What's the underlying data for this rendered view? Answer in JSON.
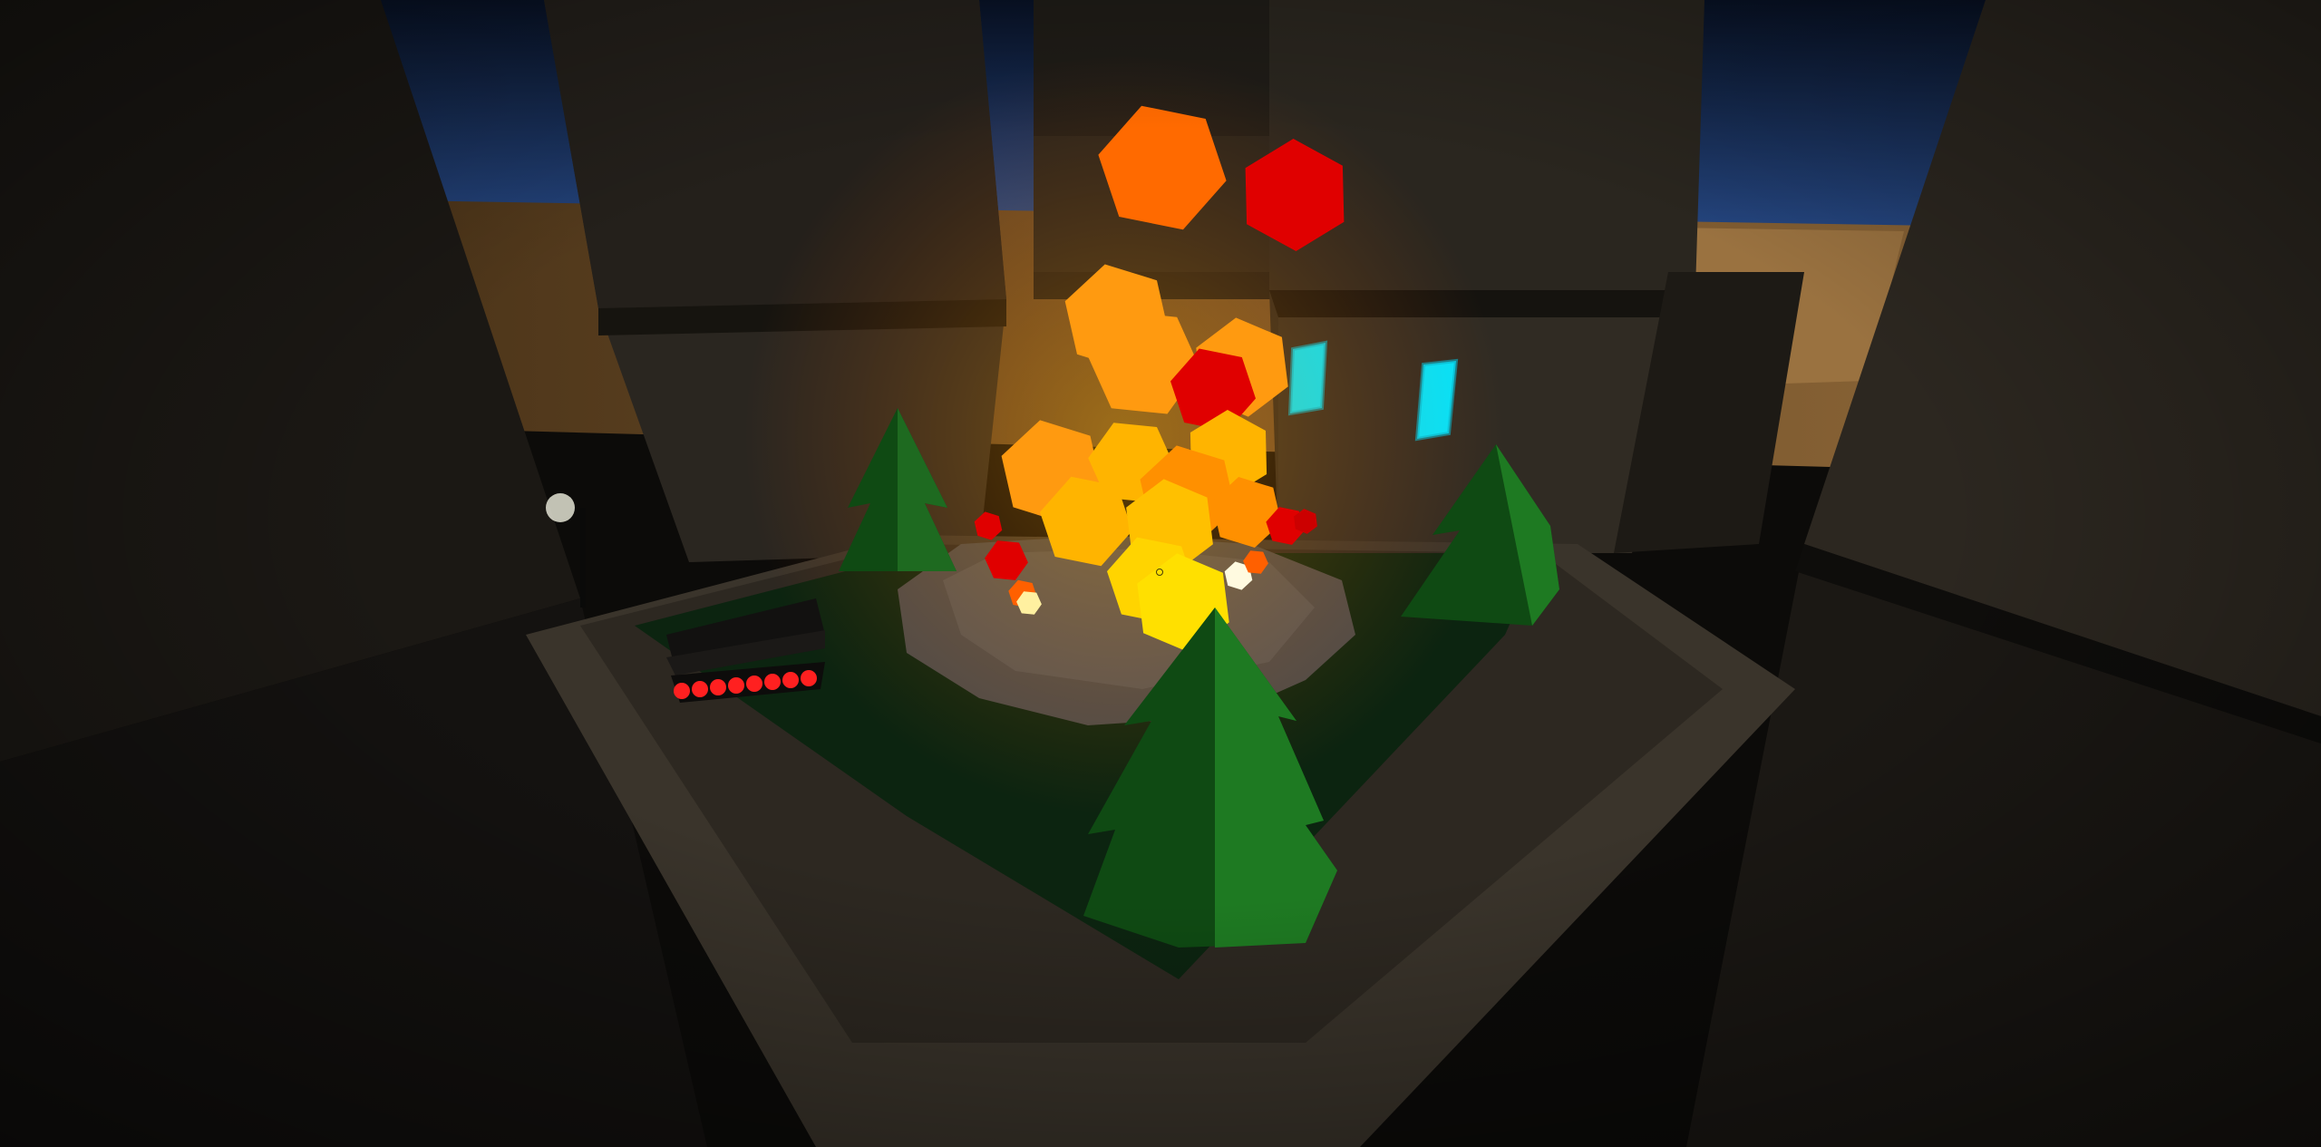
{
  "scene": {
    "setting": "night-courtyard",
    "palette": {
      "sky_top": "#0a1530",
      "sky_horizon": "#2a4d8a",
      "desert_ground": "#6b4a22",
      "building": "#2b2620",
      "building_shadow": "#15130f",
      "paving": "#3a352c",
      "grass": "#0d2a10",
      "pine_light": "#1e7a22",
      "pine_dark": "#0f4a13",
      "smoke": "#4a4a4a",
      "fire_yellow": "#ffd400",
      "fire_orange": "#ff8a00",
      "fire_red": "#e00000",
      "window_glow": "#00e5ff",
      "tank_glow": "#ff2020"
    },
    "entities": [
      {
        "kind": "explosion",
        "icon": "fireball-icon"
      },
      {
        "kind": "tank",
        "icon": "tank-icon"
      },
      {
        "kind": "pine-tree",
        "count": 3,
        "icon": "pine-tree-icon"
      },
      {
        "kind": "building",
        "count": 6,
        "icon": "building-icon"
      },
      {
        "kind": "glowing-window",
        "count": 2,
        "icon": "window-icon"
      }
    ]
  },
  "hud": {
    "crosshair": "crosshair-icon"
  }
}
